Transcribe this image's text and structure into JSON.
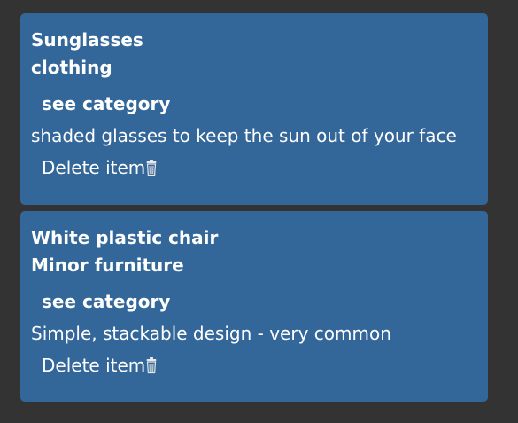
{
  "items": [
    {
      "name": "Sunglasses",
      "category": "clothing",
      "see_category_label": "see category",
      "description": "shaded glasses to keep the sun out of your face",
      "delete_label": "Delete item"
    },
    {
      "name": "White plastic chair",
      "category": "Minor furniture",
      "see_category_label": "see category",
      "description": "Simple, stackable design - very common",
      "delete_label": "Delete item"
    }
  ],
  "colors": {
    "background": "#333333",
    "card": "#336699",
    "text": "#ffffff"
  },
  "icons": {
    "delete": "trash-icon"
  }
}
